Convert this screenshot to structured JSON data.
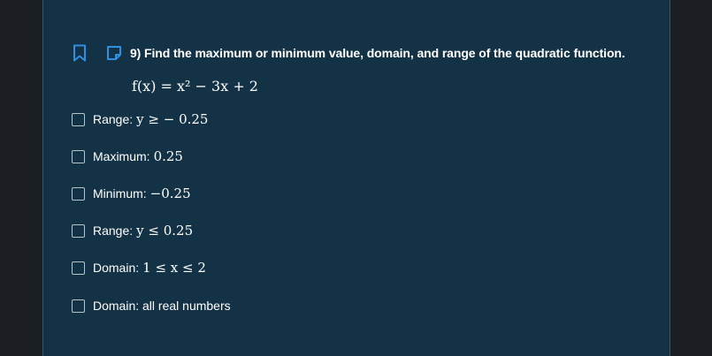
{
  "colors": {
    "background": "#1b1f24",
    "panel": "#133246",
    "accent_icon": "#2f8fe0",
    "text": "#ffffff",
    "checkbox_border": "#b9c3cc"
  },
  "question": {
    "bookmark_icon": "bookmark-icon",
    "note_icon": "note-icon",
    "text": "9) Find the maximum or minimum value, domain, and range of the quadratic function.",
    "formula": "f(x) = x² − 3x + 2"
  },
  "options": [
    {
      "label": "Range:",
      "math": "y ≥  − 0.25",
      "checked": false
    },
    {
      "label": "Maximum:",
      "math": "0.25",
      "checked": false
    },
    {
      "label": "Minimum:",
      "math": "−0.25",
      "checked": false
    },
    {
      "label": "Range:",
      "math": "y ≤ 0.25",
      "checked": false
    },
    {
      "label": "Domain:",
      "math": "1 ≤ x ≤ 2",
      "checked": false
    },
    {
      "label": "Domain: all real numbers",
      "math": "",
      "checked": false
    }
  ]
}
